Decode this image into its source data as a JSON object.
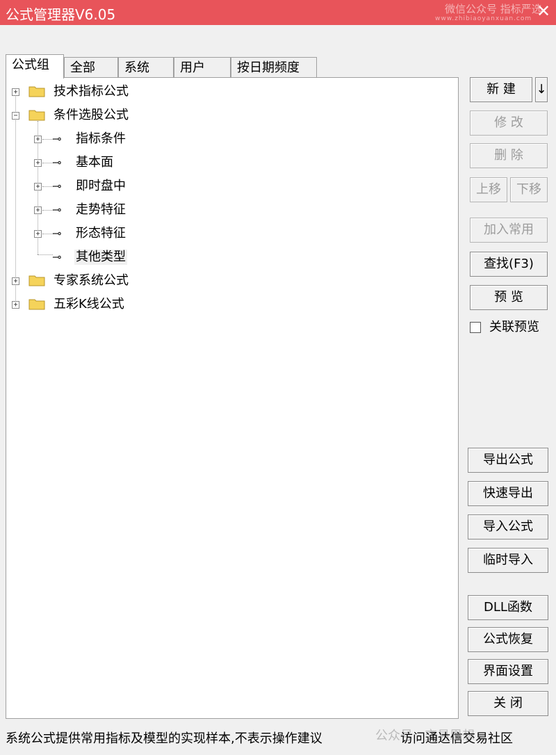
{
  "window": {
    "title": "公式管理器V6.05",
    "watermark_top": "微信公众号 指标严选",
    "watermark_url": "www.zhibiaoyanxuan.com",
    "close_glyph": "✕"
  },
  "tabs": [
    {
      "label": "公式组",
      "active": true
    },
    {
      "label": "全部",
      "active": false
    },
    {
      "label": "系统",
      "active": false
    },
    {
      "label": "用户",
      "active": false
    },
    {
      "label": "按日期频度",
      "active": false
    }
  ],
  "tree": {
    "groups": [
      {
        "label": "技术指标公式",
        "expanded": false,
        "icon": "folder-icon"
      },
      {
        "label": "条件选股公式",
        "expanded": true,
        "icon": "folder-icon",
        "children": [
          {
            "label": "指标条件",
            "icon": "key-icon",
            "has_children": true
          },
          {
            "label": "基本面",
            "icon": "key-icon",
            "has_children": true
          },
          {
            "label": "即时盘中",
            "icon": "key-icon",
            "has_children": true
          },
          {
            "label": "走势特征",
            "icon": "key-icon",
            "has_children": true
          },
          {
            "label": "形态特征",
            "icon": "key-icon",
            "has_children": true
          },
          {
            "label": "其他类型",
            "icon": "key-icon",
            "has_children": false,
            "selected": true
          }
        ]
      },
      {
        "label": "专家系统公式",
        "expanded": false,
        "icon": "folder-icon"
      },
      {
        "label": "五彩K线公式",
        "expanded": false,
        "icon": "folder-icon"
      }
    ]
  },
  "buttons": {
    "new": "新 建",
    "new_arrow": "↓",
    "modify": "修 改",
    "delete": "删 除",
    "move_up": "上移",
    "move_down": "下移",
    "add_common": "加入常用",
    "find": "查找(F3)",
    "preview": "预 览",
    "link_preview": "关联预览",
    "export": "导出公式",
    "quick_export": "快速导出",
    "import": "导入公式",
    "temp_import": "临时导入",
    "dll": "DLL函数",
    "restore": "公式恢复",
    "ui_settings": "界面设置",
    "close": "关 闭"
  },
  "status": {
    "text": "系统公式提供常用指标及模型的实现样本,不表示操作建议",
    "right": "访问通达信交易社区",
    "watermark": "公众号 · 交易思想"
  },
  "colors": {
    "titlebar": "#e8545a",
    "window_bg": "#f0f0f0",
    "disabled_text": "#9c9c9c",
    "folder": "#f5d35a"
  }
}
